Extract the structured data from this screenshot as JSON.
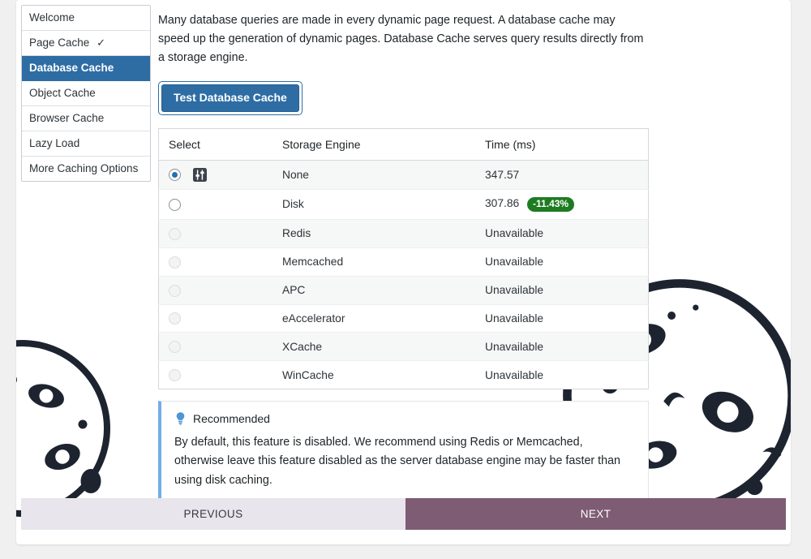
{
  "sidebar": {
    "items": [
      {
        "label": "Welcome",
        "active": false,
        "check": ""
      },
      {
        "label": "Page Cache",
        "active": false,
        "check": "✓"
      },
      {
        "label": "Database Cache",
        "active": true,
        "check": ""
      },
      {
        "label": "Object Cache",
        "active": false,
        "check": ""
      },
      {
        "label": "Browser Cache",
        "active": false,
        "check": ""
      },
      {
        "label": "Lazy Load",
        "active": false,
        "check": ""
      },
      {
        "label": "More Caching Options",
        "active": false,
        "check": ""
      }
    ]
  },
  "main": {
    "intro": "Many database queries are made in every dynamic page request. A database cache may speed up the generation of dynamic pages. Database Cache serves query results directly from a storage engine.",
    "test_button_label": "Test Database Cache",
    "table": {
      "headers": [
        "Select",
        "Storage Engine",
        "Time (ms)"
      ],
      "rows": [
        {
          "engine": "None",
          "time": "347.57",
          "badge": "",
          "selected": true,
          "disabled": false,
          "has_settings_icon": true
        },
        {
          "engine": "Disk",
          "time": "307.86",
          "badge": "-11.43%",
          "selected": false,
          "disabled": false,
          "has_settings_icon": false
        },
        {
          "engine": "Redis",
          "time": "Unavailable",
          "badge": "",
          "selected": false,
          "disabled": true,
          "has_settings_icon": false
        },
        {
          "engine": "Memcached",
          "time": "Unavailable",
          "badge": "",
          "selected": false,
          "disabled": true,
          "has_settings_icon": false
        },
        {
          "engine": "APC",
          "time": "Unavailable",
          "badge": "",
          "selected": false,
          "disabled": true,
          "has_settings_icon": false
        },
        {
          "engine": "eAccelerator",
          "time": "Unavailable",
          "badge": "",
          "selected": false,
          "disabled": true,
          "has_settings_icon": false
        },
        {
          "engine": "XCache",
          "time": "Unavailable",
          "badge": "",
          "selected": false,
          "disabled": true,
          "has_settings_icon": false
        },
        {
          "engine": "WinCache",
          "time": "Unavailable",
          "badge": "",
          "selected": false,
          "disabled": true,
          "has_settings_icon": false
        }
      ]
    },
    "notice": {
      "title": "Recommended",
      "icon": "lightbulb-icon",
      "body": "By default, this feature is disabled. We recommend using Redis or Memcached, otherwise leave this feature disabled as the server database engine may be faster than using disk caching."
    }
  },
  "footer": {
    "previous_label": "PREVIOUS",
    "next_label": "NEXT"
  },
  "colors": {
    "active_nav": "#2e6da4",
    "primary_button": "#2e6da4",
    "badge_green": "#1e7b22",
    "next_button": "#7d5c74",
    "previous_button": "#e8e6ec",
    "notice_accent": "#72aee6"
  }
}
